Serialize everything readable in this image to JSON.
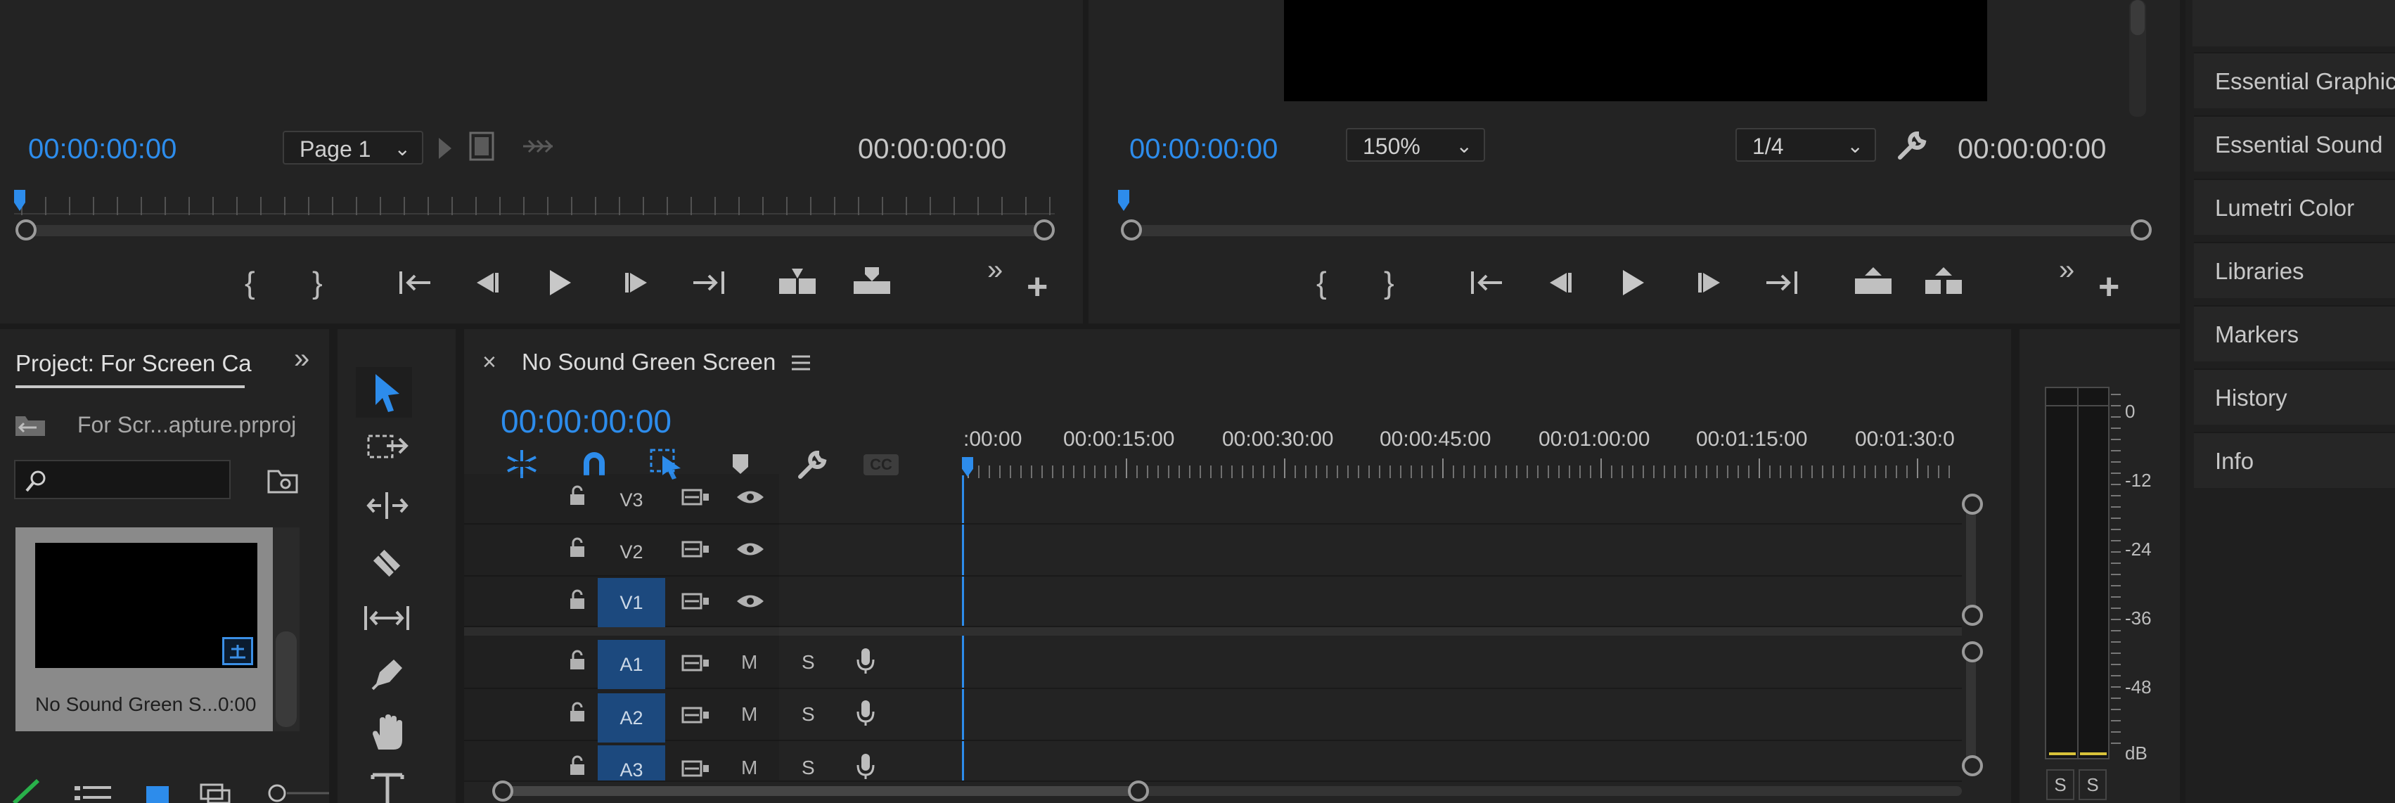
{
  "source_monitor": {
    "timecode_in": "00:00:00:00",
    "page_select": "Page 1",
    "timecode_duration": "00:00:00:00"
  },
  "program_monitor": {
    "timecode_in": "00:00:00:00",
    "zoom_select": "150%",
    "resolution_select": "1/4",
    "timecode_duration": "00:00:00:00"
  },
  "right_panel": {
    "items": [
      "Essential Graphics",
      "Essential Sound",
      "Lumetri Color",
      "Libraries",
      "Markers",
      "History",
      "Info"
    ]
  },
  "project": {
    "tab_title": "Project: For Screen Ca",
    "file_name": "For Scr...apture.prproj",
    "clip_name": "No Sound Green S...",
    "clip_duration": "0:00"
  },
  "timeline": {
    "sequence_name": "No Sound Green Screen",
    "timecode": "00:00:00:00",
    "ruler_labels": [
      ":00:00",
      "00:00:15:00",
      "00:00:30:00",
      "00:00:45:00",
      "00:01:00:00",
      "00:01:15:00",
      "00:01:30:0"
    ],
    "video_tracks": [
      "V3",
      "V2",
      "V1"
    ],
    "audio_tracks": [
      "A1",
      "A2",
      "A3"
    ],
    "track_m_label": "M",
    "track_s_label": "S",
    "cc_label": "CC"
  },
  "audio_meter": {
    "scale": [
      "0",
      "-12",
      "-24",
      "-36",
      "-48",
      "dB"
    ],
    "solo_labels": [
      "S",
      "S"
    ]
  },
  "colors": {
    "accent_blue": "#2d8ceb",
    "track_target_blue": "#1e4e86",
    "panel_bg": "#232323"
  }
}
